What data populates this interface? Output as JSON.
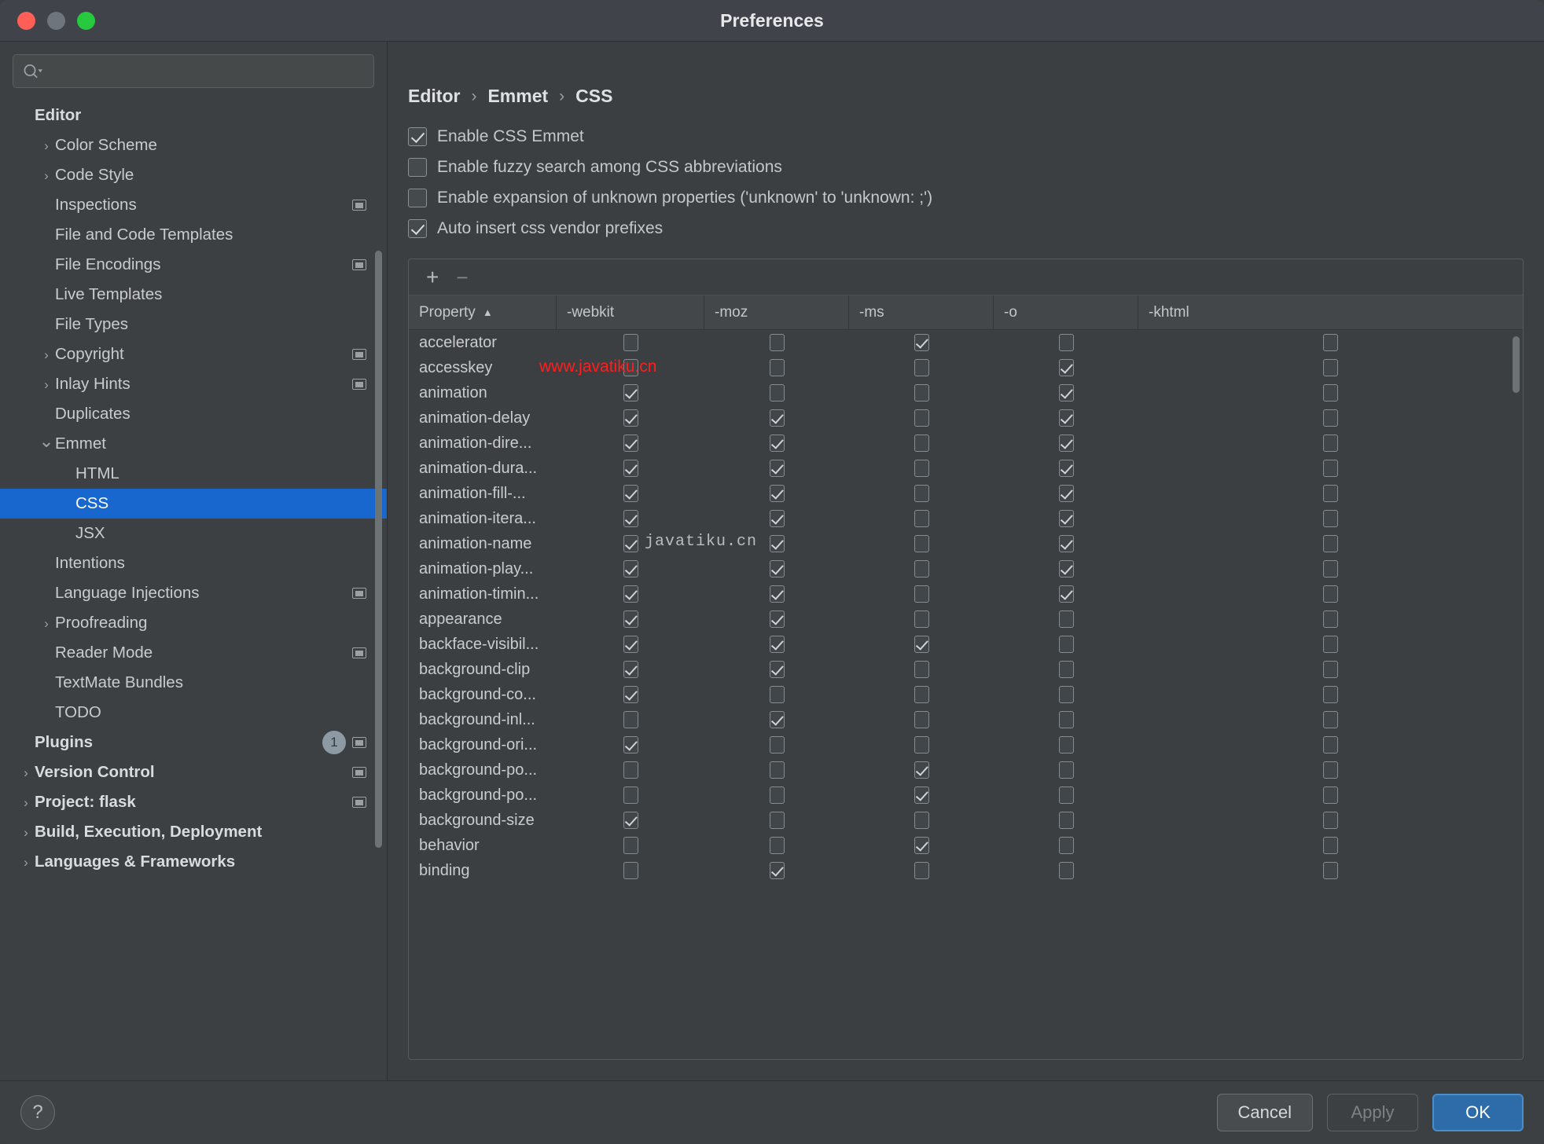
{
  "window": {
    "title": "Preferences",
    "traffic_lights": [
      "close",
      "minimize",
      "zoom"
    ]
  },
  "sidebar": {
    "search": {
      "value": "",
      "placeholder": ""
    },
    "items": [
      {
        "label": "Editor",
        "indent": 0,
        "chevron": "none",
        "bold": true,
        "selected": false,
        "copyable": false
      },
      {
        "label": "Color Scheme",
        "indent": 1,
        "chevron": "right",
        "bold": false,
        "selected": false,
        "copyable": false
      },
      {
        "label": "Code Style",
        "indent": 1,
        "chevron": "right",
        "bold": false,
        "selected": false,
        "copyable": false
      },
      {
        "label": "Inspections",
        "indent": 1,
        "chevron": "none",
        "bold": false,
        "selected": false,
        "copyable": true
      },
      {
        "label": "File and Code Templates",
        "indent": 1,
        "chevron": "none",
        "bold": false,
        "selected": false,
        "copyable": false
      },
      {
        "label": "File Encodings",
        "indent": 1,
        "chevron": "none",
        "bold": false,
        "selected": false,
        "copyable": true
      },
      {
        "label": "Live Templates",
        "indent": 1,
        "chevron": "none",
        "bold": false,
        "selected": false,
        "copyable": false
      },
      {
        "label": "File Types",
        "indent": 1,
        "chevron": "none",
        "bold": false,
        "selected": false,
        "copyable": false
      },
      {
        "label": "Copyright",
        "indent": 1,
        "chevron": "right",
        "bold": false,
        "selected": false,
        "copyable": true
      },
      {
        "label": "Inlay Hints",
        "indent": 1,
        "chevron": "right",
        "bold": false,
        "selected": false,
        "copyable": true
      },
      {
        "label": "Duplicates",
        "indent": 1,
        "chevron": "none",
        "bold": false,
        "selected": false,
        "copyable": false
      },
      {
        "label": "Emmet",
        "indent": 1,
        "chevron": "down",
        "bold": false,
        "selected": false,
        "copyable": false
      },
      {
        "label": "HTML",
        "indent": 2,
        "chevron": "none",
        "bold": false,
        "selected": false,
        "copyable": false
      },
      {
        "label": "CSS",
        "indent": 2,
        "chevron": "none",
        "bold": false,
        "selected": true,
        "copyable": false
      },
      {
        "label": "JSX",
        "indent": 2,
        "chevron": "none",
        "bold": false,
        "selected": false,
        "copyable": false
      },
      {
        "label": "Intentions",
        "indent": 1,
        "chevron": "none",
        "bold": false,
        "selected": false,
        "copyable": false
      },
      {
        "label": "Language Injections",
        "indent": 1,
        "chevron": "none",
        "bold": false,
        "selected": false,
        "copyable": true
      },
      {
        "label": "Proofreading",
        "indent": 1,
        "chevron": "right",
        "bold": false,
        "selected": false,
        "copyable": false
      },
      {
        "label": "Reader Mode",
        "indent": 1,
        "chevron": "none",
        "bold": false,
        "selected": false,
        "copyable": true
      },
      {
        "label": "TextMate Bundles",
        "indent": 1,
        "chevron": "none",
        "bold": false,
        "selected": false,
        "copyable": false
      },
      {
        "label": "TODO",
        "indent": 1,
        "chevron": "none",
        "bold": false,
        "selected": false,
        "copyable": false
      },
      {
        "label": "Plugins",
        "indent": 0,
        "chevron": "none",
        "bold": true,
        "selected": false,
        "copyable": true,
        "badge": "1"
      },
      {
        "label": "Version Control",
        "indent": 0,
        "chevron": "right",
        "bold": true,
        "selected": false,
        "copyable": true
      },
      {
        "label": "Project: flask",
        "indent": 0,
        "chevron": "right",
        "bold": true,
        "selected": false,
        "copyable": true
      },
      {
        "label": "Build, Execution, Deployment",
        "indent": 0,
        "chevron": "right",
        "bold": true,
        "selected": false,
        "copyable": false
      },
      {
        "label": "Languages & Frameworks",
        "indent": 0,
        "chevron": "right",
        "bold": true,
        "selected": false,
        "copyable": false
      }
    ]
  },
  "breadcrumb": {
    "parts": [
      "Editor",
      "Emmet",
      "CSS"
    ],
    "separator": "›"
  },
  "options": [
    {
      "label": "Enable CSS Emmet",
      "checked": true
    },
    {
      "label": "Enable fuzzy search among CSS abbreviations",
      "checked": false
    },
    {
      "label": "Enable expansion of unknown properties ('unknown' to 'unknown: ;')",
      "checked": false
    },
    {
      "label": "Auto insert css vendor prefixes",
      "checked": true
    }
  ],
  "table": {
    "toolbar": {
      "add": "+",
      "remove": "−"
    },
    "columns": [
      "Property",
      "-webkit",
      "-moz",
      "-ms",
      "-o",
      "-khtml"
    ],
    "sort_column": "Property",
    "sort_direction": "asc",
    "sort_glyph": "▲",
    "rows": [
      {
        "property": "accelerator",
        "prefixes": [
          false,
          false,
          true,
          false,
          false
        ]
      },
      {
        "property": "accesskey",
        "prefixes": [
          false,
          false,
          false,
          true,
          false
        ]
      },
      {
        "property": "animation",
        "prefixes": [
          true,
          false,
          false,
          true,
          false
        ]
      },
      {
        "property": "animation-delay",
        "prefixes": [
          true,
          true,
          false,
          true,
          false
        ]
      },
      {
        "property": "animation-dire...",
        "prefixes": [
          true,
          true,
          false,
          true,
          false
        ]
      },
      {
        "property": "animation-dura...",
        "prefixes": [
          true,
          true,
          false,
          true,
          false
        ]
      },
      {
        "property": "animation-fill-...",
        "prefixes": [
          true,
          true,
          false,
          true,
          false
        ]
      },
      {
        "property": "animation-itera...",
        "prefixes": [
          true,
          true,
          false,
          true,
          false
        ]
      },
      {
        "property": "animation-name",
        "prefixes": [
          true,
          true,
          false,
          true,
          false
        ]
      },
      {
        "property": "animation-play...",
        "prefixes": [
          true,
          true,
          false,
          true,
          false
        ]
      },
      {
        "property": "animation-timin...",
        "prefixes": [
          true,
          true,
          false,
          true,
          false
        ]
      },
      {
        "property": "appearance",
        "prefixes": [
          true,
          true,
          false,
          false,
          false
        ]
      },
      {
        "property": "backface-visibil...",
        "prefixes": [
          true,
          true,
          true,
          false,
          false
        ]
      },
      {
        "property": "background-clip",
        "prefixes": [
          true,
          true,
          false,
          false,
          false
        ]
      },
      {
        "property": "background-co...",
        "prefixes": [
          true,
          false,
          false,
          false,
          false
        ]
      },
      {
        "property": "background-inl...",
        "prefixes": [
          false,
          true,
          false,
          false,
          false
        ]
      },
      {
        "property": "background-ori...",
        "prefixes": [
          true,
          false,
          false,
          false,
          false
        ]
      },
      {
        "property": "background-po...",
        "prefixes": [
          false,
          false,
          true,
          false,
          false
        ]
      },
      {
        "property": "background-po...",
        "prefixes": [
          false,
          false,
          true,
          false,
          false
        ]
      },
      {
        "property": "background-size",
        "prefixes": [
          true,
          false,
          false,
          false,
          false
        ]
      },
      {
        "property": "behavior",
        "prefixes": [
          false,
          false,
          true,
          false,
          false
        ]
      },
      {
        "property": "binding",
        "prefixes": [
          false,
          true,
          false,
          false,
          false
        ]
      }
    ]
  },
  "watermarks": {
    "red": "www.javatiku.cn",
    "gray": "javatiku.cn"
  },
  "footer": {
    "help": "?",
    "cancel": "Cancel",
    "apply": "Apply",
    "ok": "OK"
  }
}
